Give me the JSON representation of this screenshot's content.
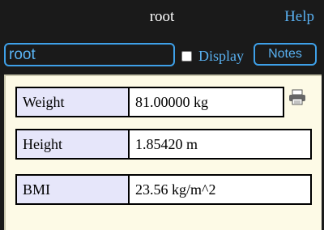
{
  "header": {
    "title": "root",
    "help_label": "Help"
  },
  "toolbar": {
    "name_value": "root",
    "display_label": "Display",
    "display_checked": false,
    "notes_label": "Notes"
  },
  "rows": [
    {
      "label": "Weight",
      "value": "81.00000 kg"
    },
    {
      "label": "Height",
      "value": "1.85420 m"
    },
    {
      "label": "BMI",
      "value": "23.56 kg/m^2"
    }
  ],
  "icons": {
    "print": "printer-icon"
  },
  "colors": {
    "accent": "#3ea0e8",
    "label_bg": "#e6e6fa",
    "panel_bg": "#fdfae6",
    "bar_bg": "#1a1a1a"
  }
}
